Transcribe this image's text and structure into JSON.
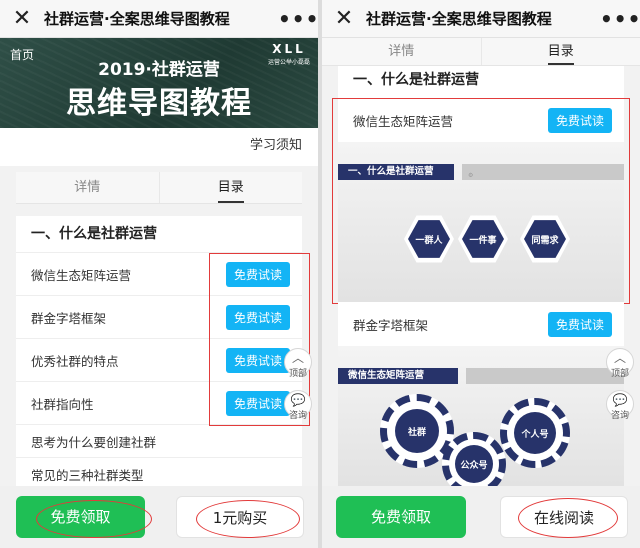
{
  "left": {
    "nav": {
      "close_icon": "close-icon",
      "title": "社群运营·全案思维导图教程",
      "more_icon": "more-icon"
    },
    "banner": {
      "home": "首页",
      "logo_letters": "XLL",
      "logo_sub": "运营公举小磊磊",
      "subtitle": "2019·社群运营",
      "title": "思维导图教程"
    },
    "notice": "学习须知",
    "tabs": [
      {
        "label": "详情"
      },
      {
        "label": "目录"
      }
    ],
    "section_title": "一、什么是社群运营",
    "items": [
      {
        "label": "微信生态矩阵运营",
        "trial": "免费试读"
      },
      {
        "label": "群金字塔框架",
        "trial": "免费试读"
      },
      {
        "label": "优秀社群的特点",
        "trial": "免费试读"
      },
      {
        "label": "社群指向性",
        "trial": "免费试读"
      }
    ],
    "plain_items": [
      "思考为什么要创建社群",
      "常见的三种社群类型"
    ],
    "float": {
      "top_label": "顶部",
      "consult_label": "咨询"
    },
    "bottom": {
      "green_label": "免费领取",
      "white_label": "1元购买"
    }
  },
  "right": {
    "nav": {
      "close_icon": "close-icon",
      "title": "社群运营·全案思维导图教程",
      "more_icon": "more-icon"
    },
    "tabs": [
      {
        "label": "详情"
      },
      {
        "label": "目录"
      }
    ],
    "section_title": "一、什么是社群运营",
    "item1": {
      "label": "微信生态矩阵运营",
      "trial": "免费试读"
    },
    "mind1": {
      "header": "一、什么是社群运营",
      "hexes": [
        "一群人",
        "一件事",
        "同需求"
      ]
    },
    "item2": {
      "label": "群金字塔框架",
      "trial": "免费试读"
    },
    "mind2": {
      "header": "微信生态矩阵运营",
      "gears": [
        "社群",
        "公众号",
        "个人号"
      ]
    },
    "float": {
      "top_label": "顶部",
      "consult_label": "咨询"
    },
    "bottom": {
      "green_label": "免费领取",
      "white_label": "在线阅读"
    }
  },
  "colors": {
    "accent_blue": "#13b4f5",
    "green": "#1fbf55",
    "navy": "#27336a",
    "highlight_red": "#e23b3b"
  }
}
